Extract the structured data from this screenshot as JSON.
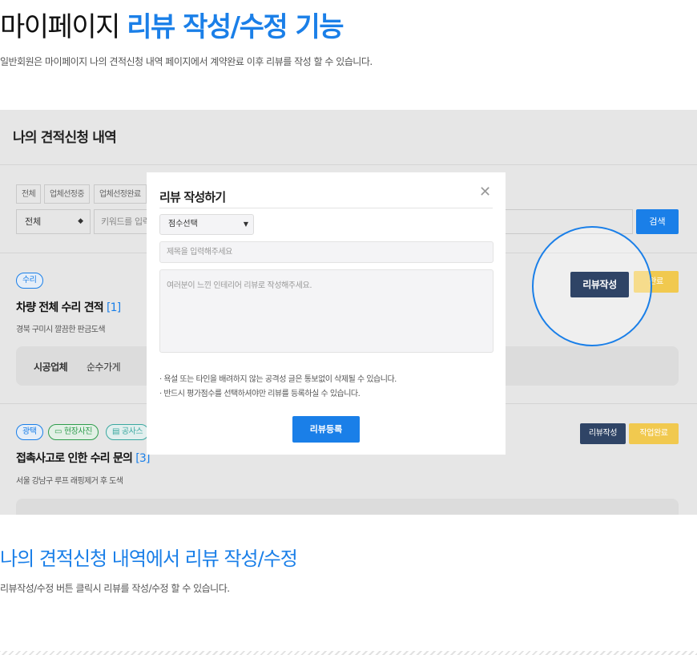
{
  "header": {
    "title_prefix": "마이페이지",
    "title_accent": "리뷰 작성/수정 기능",
    "description": "일반회원은 마이페이지 나의 견적신청 내역 페이지에서 계약완료 이후 리뷰를 작성 할 수 있습니다."
  },
  "screenshot": {
    "title": "나의 견적신청 내역",
    "filters": [
      "전체",
      "업체선정중",
      "업체선정완료"
    ],
    "select_value": "전체",
    "keyword_placeholder": "키워드를 입력",
    "search_label": "검색",
    "items": [
      {
        "tags": [
          "수리"
        ],
        "title": "차량 전체 수리 견적",
        "count": "[1]",
        "address": "경북 구미시 깔끔한 판금도색",
        "info_label": "시공업체",
        "info_value": "순수가게",
        "review_label": "리뷰작성",
        "done_label": "작업완료"
      },
      {
        "tags": [
          "광택",
          "현장사진",
          "공사스"
        ],
        "title": "접촉사고로 인한 수리 문의",
        "count": "[3]",
        "address": "서울 강남구 루프 래핑제거 후 도색",
        "review_label": "리뷰작성",
        "done_label": "작업완료"
      }
    ]
  },
  "modal": {
    "title": "리뷰 작성하기",
    "close_glyph": "✕",
    "score_placeholder": "점수선택",
    "title_placeholder": "제목을 입력해주세요",
    "content_placeholder": "여러분이 느낀 인테리어 리뷰로 작성해주세요.",
    "notices": [
      "· 욕설 또는 타인을 배려하지 않는 공격성 글은 통보없이 삭제될 수 있습니다.",
      "· 반드시 평가점수를 선택하셔야만 리뷰를 등록하실 수 있습니다."
    ],
    "submit_label": "리뷰등록"
  },
  "highlight": {
    "review_label": "리뷰작성",
    "done_label_partial": "완료"
  },
  "section": {
    "title": "나의 견적신청 내역에서 리뷰 작성/수정",
    "description": "리뷰작성/수정 버튼 클릭시 리뷰를 작성/수정 할 수 있습니다."
  },
  "colors": {
    "accent": "#1a7fe8",
    "review_button": "#2f4466",
    "done_button": "#f1c94f"
  }
}
